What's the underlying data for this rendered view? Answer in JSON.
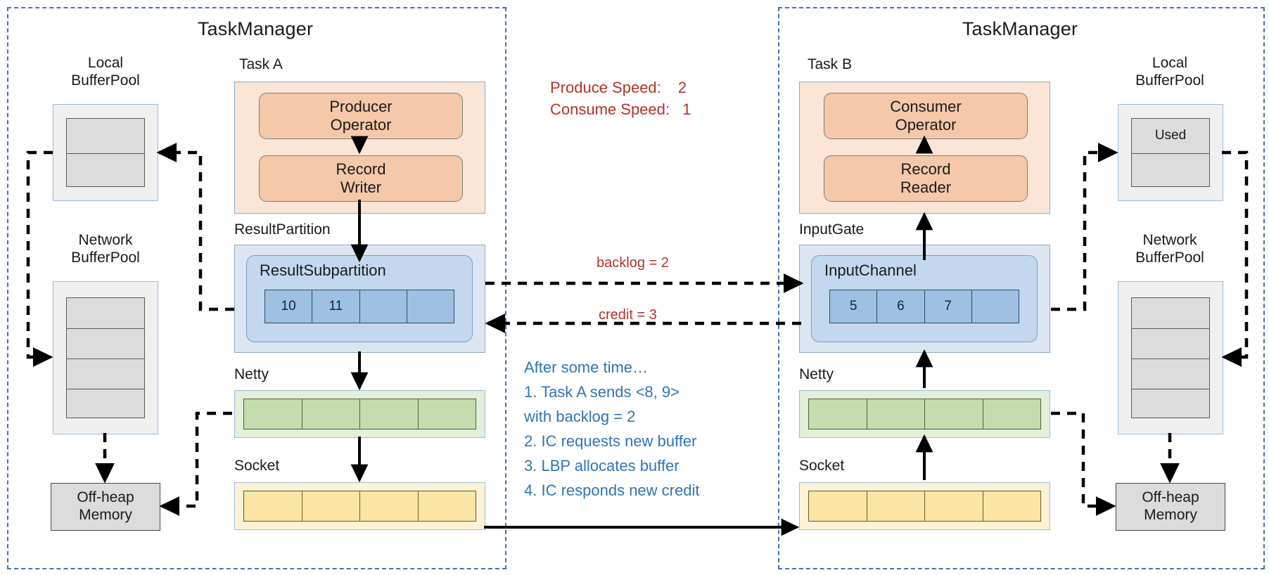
{
  "left_panel": {
    "title": "TaskManager",
    "local_pool": {
      "caption_line1": "Local",
      "caption_line2": "BufferPool",
      "cells": [
        "",
        ""
      ]
    },
    "network_pool": {
      "caption_line1": "Network",
      "caption_line2": "BufferPool",
      "cells": [
        "",
        "",
        "",
        ""
      ]
    },
    "offheap": {
      "line1": "Off-heap",
      "line2": "Memory"
    },
    "task": {
      "caption": "Task A",
      "op1_line1": "Producer",
      "op1_line2": "Operator",
      "op2_line1": "Record",
      "op2_line2": "Writer"
    },
    "partition": {
      "caption": "ResultPartition",
      "sub_label": "ResultSubpartition",
      "buffers": [
        "10",
        "11",
        "",
        ""
      ]
    },
    "netty": {
      "caption": "Netty",
      "cells": [
        "",
        "",
        "",
        ""
      ]
    },
    "socket": {
      "caption": "Socket",
      "cells": [
        "",
        "",
        "",
        ""
      ]
    }
  },
  "right_panel": {
    "title": "TaskManager",
    "local_pool": {
      "caption_line1": "Local",
      "caption_line2": "BufferPool",
      "cells": [
        "Used",
        ""
      ]
    },
    "network_pool": {
      "caption_line1": "Network",
      "caption_line2": "BufferPool",
      "cells": [
        "",
        "",
        "",
        ""
      ]
    },
    "offheap": {
      "line1": "Off-heap",
      "line2": "Memory"
    },
    "task": {
      "caption": "Task B",
      "op1_line1": "Consumer",
      "op1_line2": "Operator",
      "op2_line1": "Record",
      "op2_line2": "Reader"
    },
    "gate": {
      "caption": "InputGate",
      "sub_label": "InputChannel",
      "buffers": [
        "5",
        "6",
        "7",
        ""
      ]
    },
    "netty": {
      "caption": "Netty",
      "cells": [
        "",
        "",
        "",
        ""
      ]
    },
    "socket": {
      "caption": "Socket",
      "cells": [
        "",
        "",
        "",
        ""
      ]
    }
  },
  "annotations": {
    "produce_speed_label": "Produce Speed:",
    "produce_speed_value": "2",
    "consume_speed_label": "Consume Speed:",
    "consume_speed_value": "1",
    "backlog": "backlog = 2",
    "credit": "credit = 3",
    "steps_header": "After some time…",
    "step1a": "1.    Task A sends <8, 9>",
    "step1b": "with backlog =   2",
    "step2": "2.   IC requests new buffer",
    "step3": "3.   LBP allocates buffer",
    "step4": "4.   IC responds new credit"
  },
  "colors": {
    "panel_border": "#4a72a8",
    "accent_red": "#b5322a",
    "accent_blue": "#2e75b6",
    "buffer_blue": "#9fc0e2",
    "netty_green": "#c5dcae",
    "socket_yellow": "#fae5a6",
    "task_peach": "#f4c8a8"
  }
}
